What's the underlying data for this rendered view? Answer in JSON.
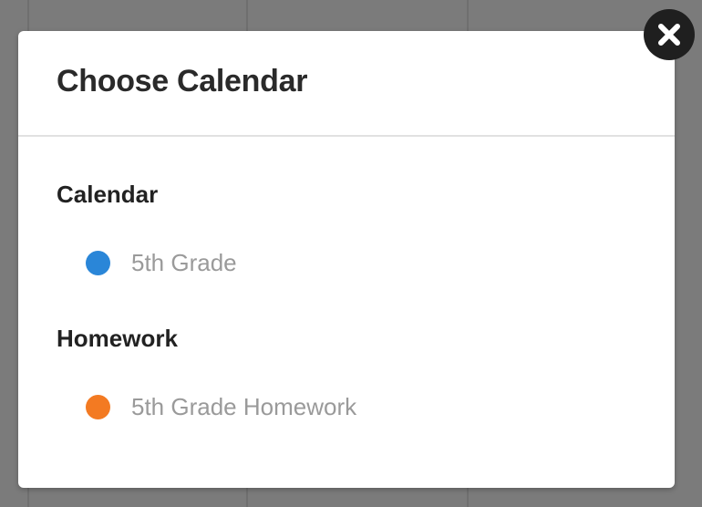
{
  "modal": {
    "title": "Choose Calendar",
    "close_icon": "close-icon"
  },
  "sections": [
    {
      "heading": "Calendar",
      "options": [
        {
          "label": "5th Grade",
          "color": "#2a86d8"
        }
      ]
    },
    {
      "heading": "Homework",
      "options": [
        {
          "label": "5th Grade Homework",
          "color": "#f37a22"
        }
      ]
    }
  ]
}
